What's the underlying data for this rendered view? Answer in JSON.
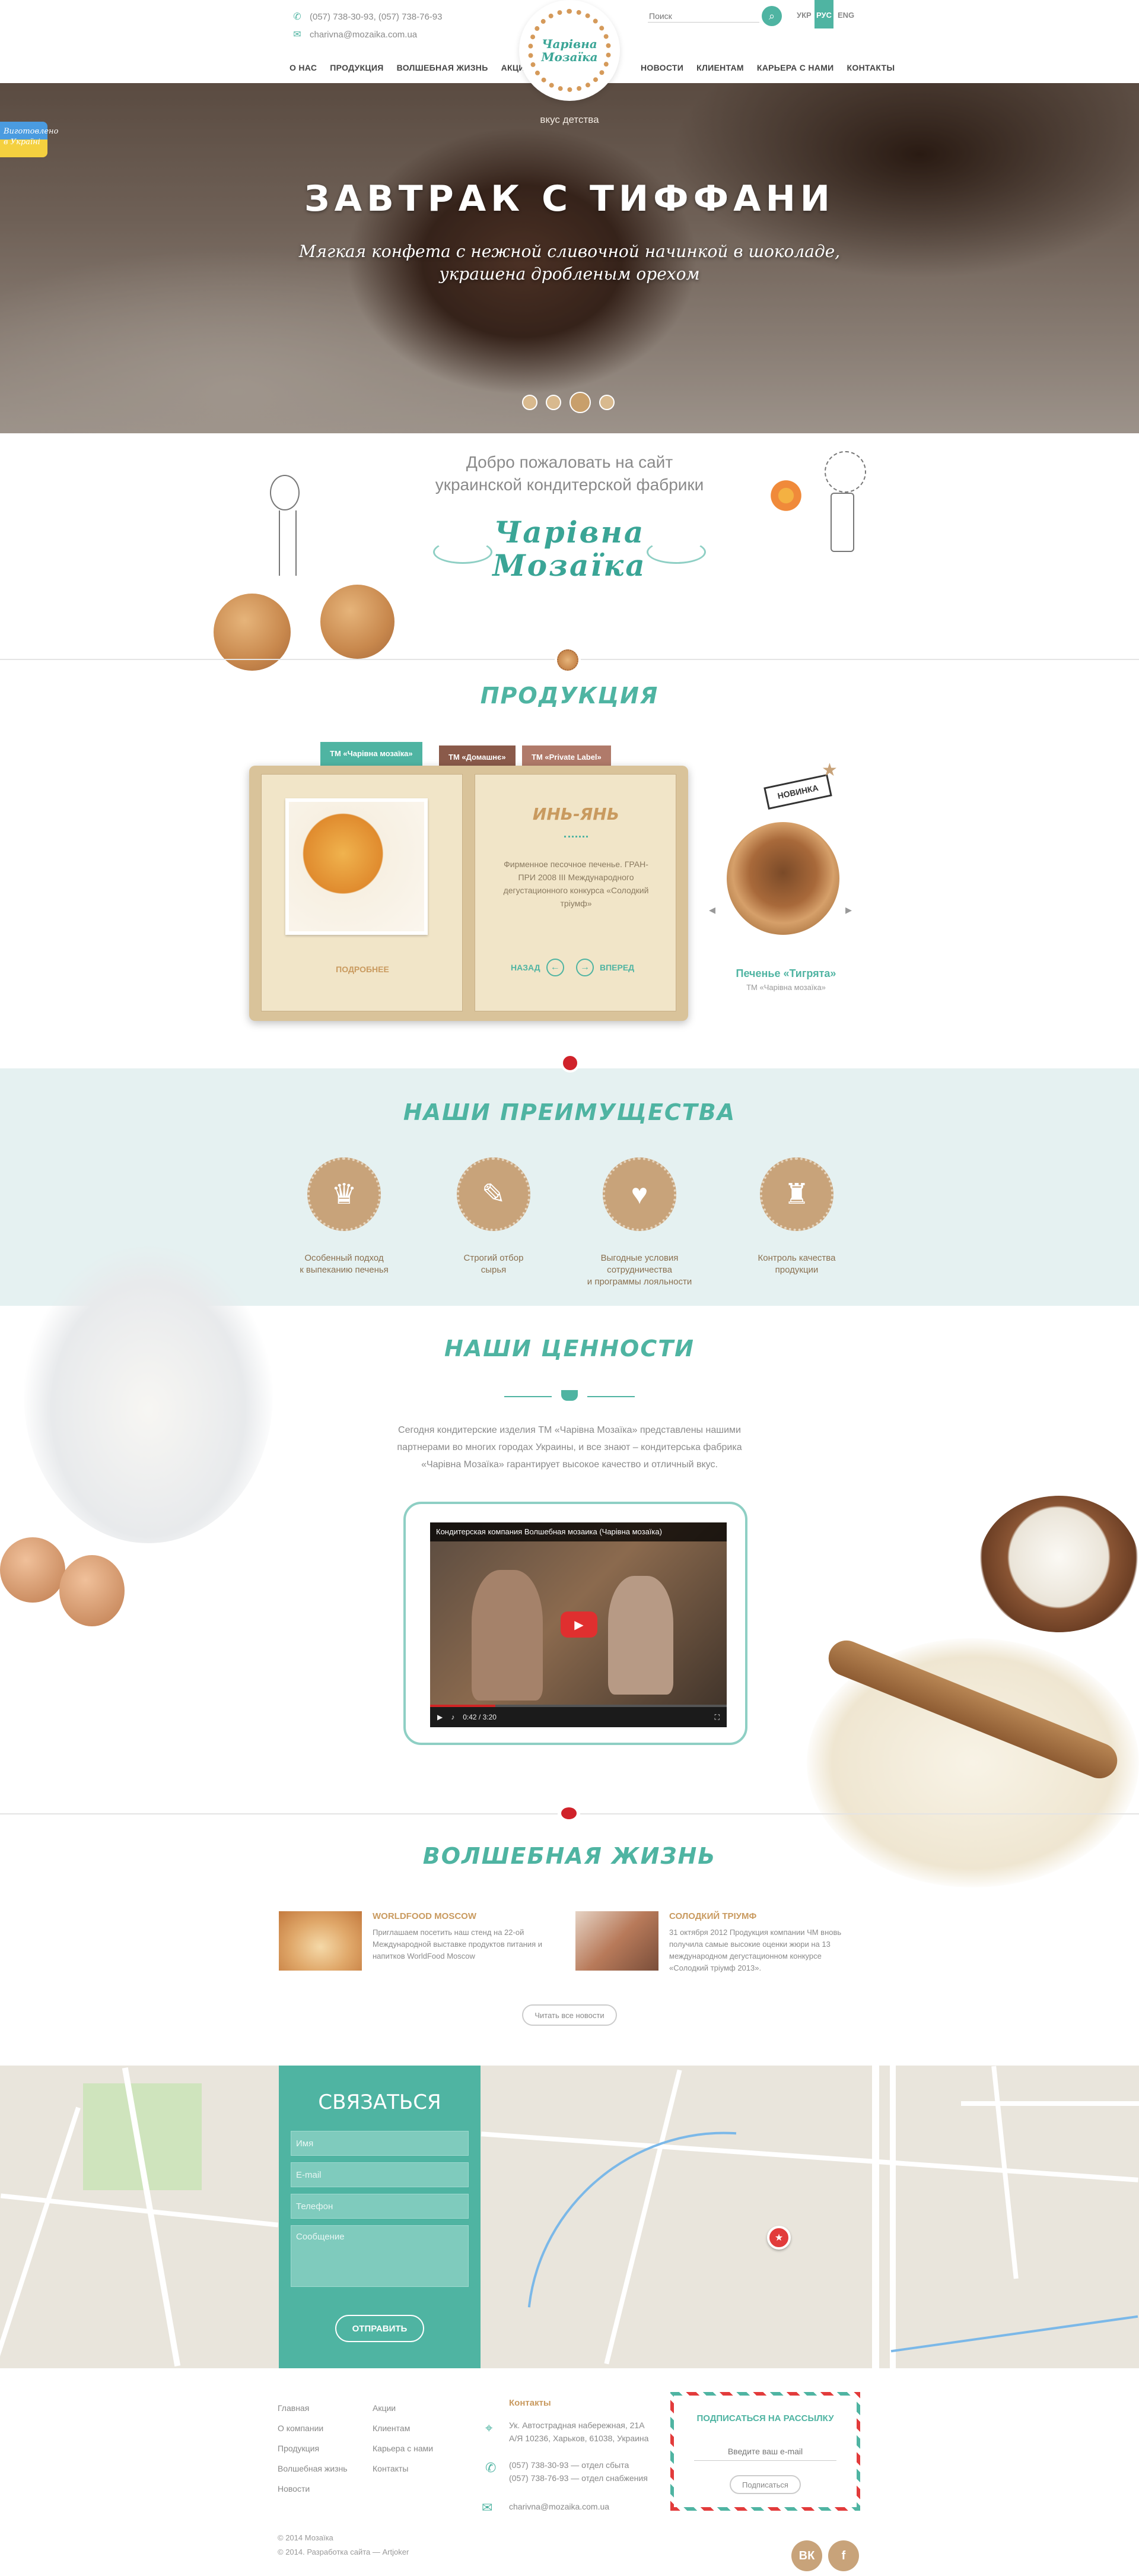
{
  "header": {
    "phones": "(057) 738-30-93, (057) 738-76-93",
    "email": "charivna@mozaika.com.ua",
    "nav_left": [
      "О нас",
      "Продукция",
      "Волшебная жизнь",
      "Акции"
    ],
    "nav_right": [
      "Новости",
      "Клиентам",
      "Карьера с нами",
      "Контакты"
    ],
    "logo_line1": "Чарівна",
    "logo_line2": "Мозаїка",
    "search_placeholder": "Поиск",
    "langs": [
      "УКР",
      "РУС",
      "ENG"
    ],
    "active_lang": "РУС"
  },
  "hero": {
    "slogan": "вкус детства",
    "title": "ЗАВТРАК С ТИФФАНИ",
    "subtitle_line1": "Мягкая конфета с нежной сливочной начинкой в шоколаде,",
    "subtitle_line2": "украшена дробленым орехом",
    "badge": "Виготовлено в Україні",
    "slides": 4,
    "active_slide": 3
  },
  "welcome": {
    "line1": "Добро пожаловать на сайт",
    "line2": "украинской кондитерской фабрики",
    "brand1": "Чарівна",
    "brand2": "Мозаїка"
  },
  "products": {
    "heading": "ПРОДУКЦИЯ",
    "tabs": [
      "ТМ «Чарівна мозаїка»",
      "ТМ «Домашнє»",
      "ТМ «Private Label»"
    ],
    "name": "ИНЬ-ЯНЬ",
    "desc": "Фирменное песочное печенье. ГРАН-ПРИ 2008 III Международного дегустационного конкурса «Солодкий тріумф»",
    "more": "Подробнее",
    "prev": "Назад",
    "next": "Вперед",
    "new_tag": "Новинка",
    "new_name": "Печенье «Тигрята»",
    "new_tm": "ТМ «Чарівна мозаїка»"
  },
  "advantages": {
    "heading": "НАШИ ПРЕИМУЩЕСТВА",
    "items": [
      {
        "line1": "Особенный подход",
        "line2": "к выпеканию печенья",
        "icon": "chef-hat-icon"
      },
      {
        "line1": "Строгий отбор",
        "line2": "сырья",
        "icon": "price-tag-icon"
      },
      {
        "line1": "Выгодные условия сотрудничества",
        "line2": "и программы лояльности",
        "icon": "heart-icon"
      },
      {
        "line1": "Контроль качества",
        "line2": "продукции",
        "icon": "trophy-icon"
      }
    ]
  },
  "values": {
    "heading": "НАШИ ЦЕННОСТИ",
    "intro": "Сегодня кондитерские изделия ТМ «Чарівна Мозаїка» представлены нашими партнерами во многих городах Украины, и все знают – кондитерська фабрика «Чарівна Мозаїка» гарантирует высокое качество и отличный вкус.",
    "video_title": "Кондитерская компания Волшебная мозаика (Чарівна мозаїка)",
    "video_time": "0:42 / 3:20"
  },
  "news": {
    "heading": "ВОЛШЕБНАЯ ЖИЗНЬ",
    "items": [
      {
        "title": "WORLDFOOD MOSCOW",
        "text": "Приглашаем посетить наш стенд на 22-ой Международной выставке продуктов питания и напитков WorldFood Moscow"
      },
      {
        "title": "Солодкий тріумф",
        "text": "31 октября 2012 Продукция компании ЧМ вновь получила самые высокие оценки жюри на 13 международном дегустационном конкурсе «Солодкий тріумф 2013»."
      }
    ],
    "all_button": "Читать все новости"
  },
  "contact": {
    "heading": "СВЯЗАТЬСЯ",
    "name_ph": "Имя",
    "email_ph": "E-mail",
    "phone_ph": "Телефон",
    "message_ph": "Сообщение",
    "send": "Отправить"
  },
  "footer": {
    "col1": [
      "Главная",
      "О компании",
      "Продукция",
      "Волшебная жизнь",
      "Новости"
    ],
    "col2": [
      "Акции",
      "Клиентам",
      "Карьера с нами",
      "Контакты"
    ],
    "contacts_heading": "Контакты",
    "addr1": "Ук. Автострадная набережная, 21А",
    "addr2": "А/Я 10236, Харьков, 61038, Украина",
    "tel1": "(057) 738-30-93 — отдел сбыта",
    "tel2": "(057) 738-76-93 — отдел снабжения",
    "email": "charivna@mozaika.com.ua",
    "subscribe_heading": "ПОДПИСАТЬСЯ НА РАССЫЛКУ",
    "subscribe_ph": "Введите ваш e-mail",
    "subscribe_btn": "Подписаться",
    "copy1": "© 2014 Мозаїка",
    "copy2": "© 2014. Разработка сайта — Artjoker",
    "social": [
      "ВК",
      "f"
    ]
  },
  "colors": {
    "accent": "#4fb4a2",
    "caramel": "#c8a37a",
    "red": "#e23b3b"
  }
}
